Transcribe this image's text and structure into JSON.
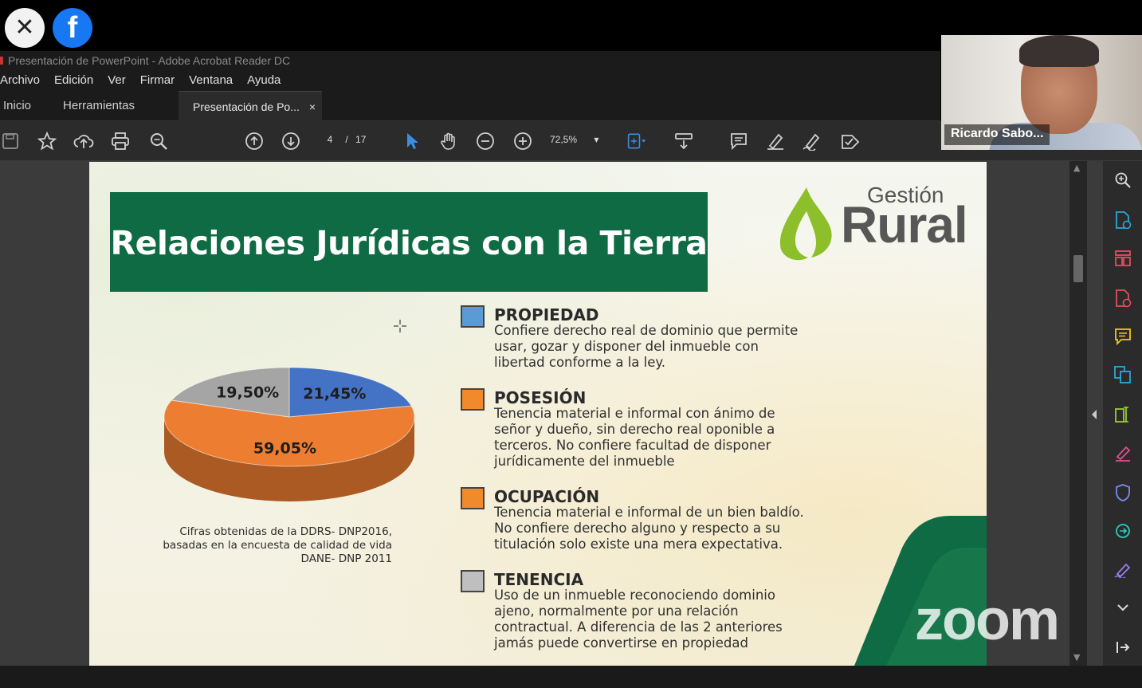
{
  "overlay": {
    "close_glyph": "✕",
    "facebook_glyph": "f"
  },
  "window": {
    "title": "Presentación de PowerPoint - Adobe Acrobat Reader DC"
  },
  "menu": [
    "Archivo",
    "Edición",
    "Ver",
    "Firmar",
    "Ventana",
    "Ayuda"
  ],
  "tabs": {
    "home": "Inicio",
    "tools": "Herramientas",
    "document": "Presentación de Po...",
    "close_glyph": "×"
  },
  "toolbar": {
    "current_page": "4",
    "page_separator": "/",
    "total_pages": "17",
    "zoom": "72,5%",
    "zoom_dropdown": "▾"
  },
  "webcam": {
    "participant_name": "Ricardo Sabo..."
  },
  "slide": {
    "title": "Relaciones Jurídicas con la Tierra",
    "logo": {
      "top": "Gestión",
      "main": "Rural"
    },
    "source_note": "Cifras obtenidas de la DDRS- DNP2016, basadas en la encuesta de calidad de vida DANE- DNP 2011",
    "legend": [
      {
        "title": "PROPIEDAD",
        "color": "#5b9bd5",
        "text": "Confiere derecho real de dominio que permite usar, gozar y disponer del inmueble con libertad conforme a la ley."
      },
      {
        "title": "POSESIÓN",
        "color": "#f08a2c",
        "text": "Tenencia material e informal con ánimo de señor y dueño, sin derecho real oponible a terceros. No confiere facultad de disponer jurídicamente del inmueble"
      },
      {
        "title": "OCUPACIÓN",
        "color": "#f08a2c",
        "text": "Tenencia material e informal de un bien baldío. No confiere derecho alguno y respecto a su titulación solo existe una mera expectativa."
      },
      {
        "title": "TENENCIA",
        "color": "#bfbfbf",
        "text": "Uso de un inmueble reconociendo dominio ajeno, normalmente por  una relación contractual. A diferencia de las 2 anteriores jamás puede convertirse en propiedad"
      }
    ]
  },
  "chart_data": {
    "type": "pie",
    "title": "",
    "slices": [
      {
        "label": "21,45%",
        "value": 21.45,
        "color": "#4472c4"
      },
      {
        "label": "59,05%",
        "value": 59.05,
        "color": "#ed7d31"
      },
      {
        "label": "19,50%",
        "value": 19.5,
        "color": "#a5a5a5"
      }
    ]
  },
  "watermark": "zoom",
  "colors": {
    "title_green": "#0f6b43",
    "logo_green": "#8cbf2a"
  }
}
